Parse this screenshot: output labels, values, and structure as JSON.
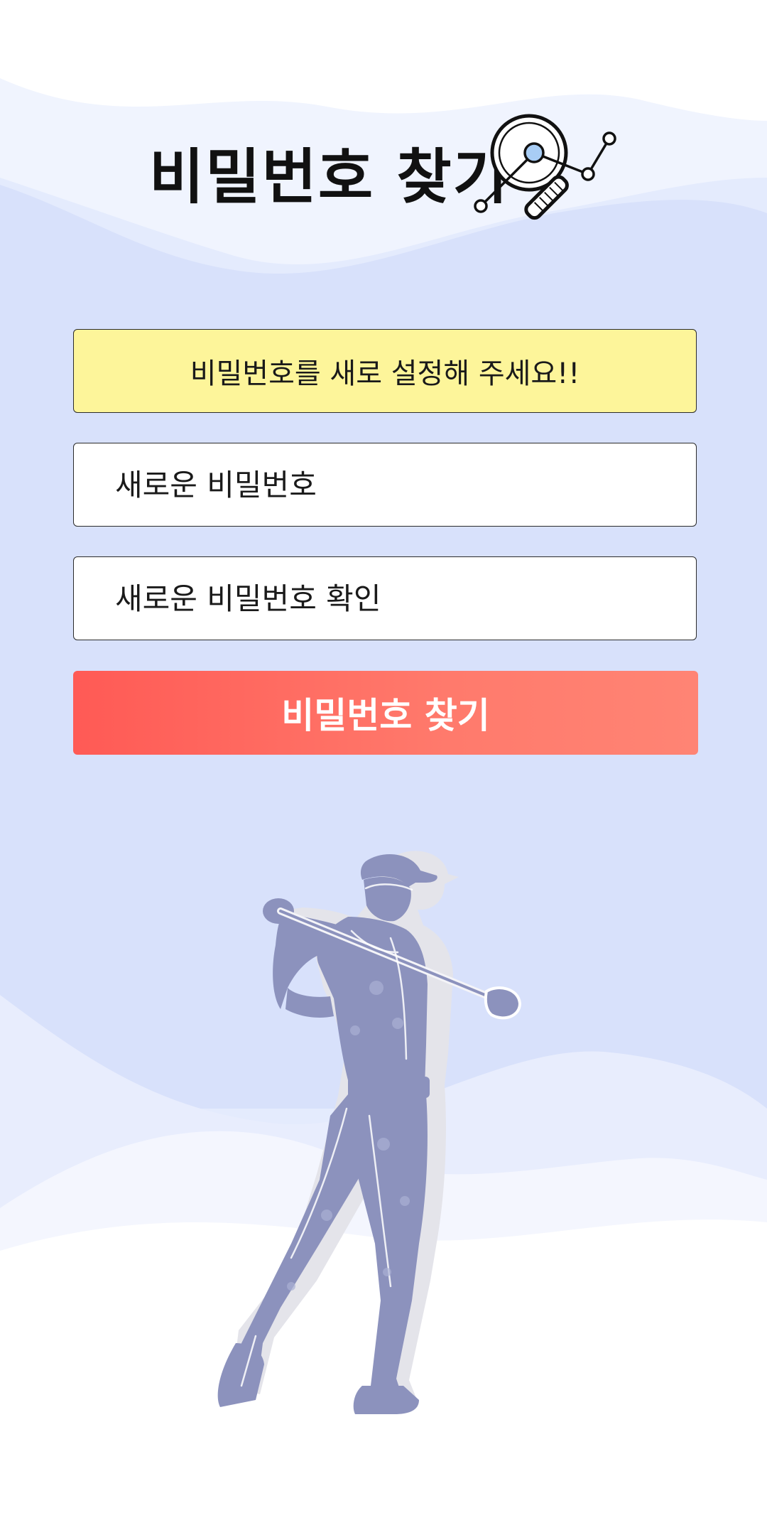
{
  "page": {
    "title": "비밀번호 찾기",
    "title_icon": "magnifier-chart-icon"
  },
  "notice": {
    "text": "비밀번호를 새로 설정해 주세요!!"
  },
  "form": {
    "new_password_placeholder": "새로운 비밀번호",
    "confirm_password_placeholder": "새로운 비밀번호 확인",
    "submit_label": "비밀번호 찾기"
  },
  "illustration": {
    "name": "golfer-silhouette"
  },
  "colors": {
    "notice_bg": "#fdf59a",
    "button_start": "#ff5a55",
    "button_end": "#ff8474",
    "wave_light": "#e6ecfd",
    "wave_mid": "#d6e0fb",
    "golfer": "#8c92bd"
  }
}
